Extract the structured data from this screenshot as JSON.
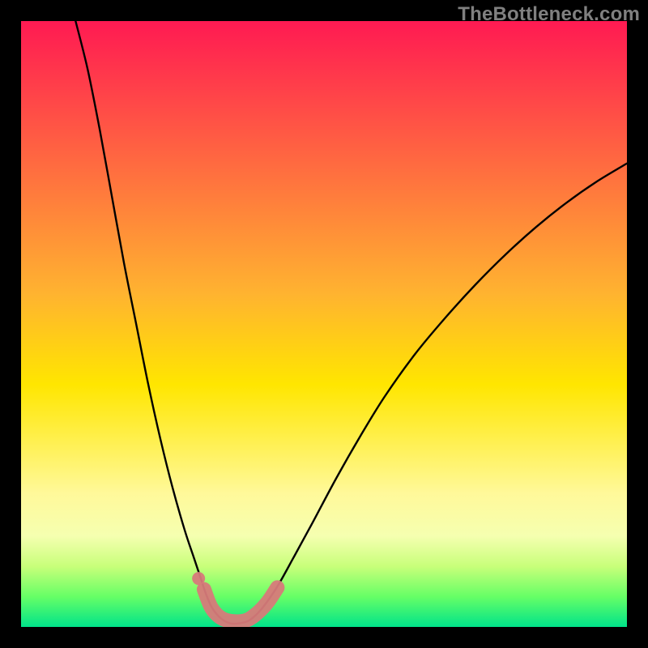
{
  "watermark": "TheBottleneck.com",
  "chart_data": {
    "type": "line",
    "title": "",
    "xlabel": "",
    "ylabel": "",
    "xlim": [
      0,
      100
    ],
    "ylim": [
      0,
      100
    ],
    "curve1_desc": "steep descending curve from top-left to trough",
    "curve2_desc": "ascending curve from trough to upper-right with diminishing slope",
    "trough_marker_desc": "rounded pink segment near bottom indicating optimal match zone",
    "background_gradient_stops": [
      {
        "offset": 0.0,
        "color": "#ff1a52"
      },
      {
        "offset": 0.45,
        "color": "#ffb330"
      },
      {
        "offset": 0.6,
        "color": "#ffe600"
      },
      {
        "offset": 0.78,
        "color": "#fff99a"
      },
      {
        "offset": 0.85,
        "color": "#f5ffb0"
      },
      {
        "offset": 0.9,
        "color": "#c8ff7a"
      },
      {
        "offset": 0.95,
        "color": "#66ff66"
      },
      {
        "offset": 1.0,
        "color": "#00e38a"
      }
    ],
    "curve1": [
      {
        "x": 9.0,
        "y": 100.0
      },
      {
        "x": 11.0,
        "y": 92.0
      },
      {
        "x": 13.0,
        "y": 82.0
      },
      {
        "x": 15.0,
        "y": 71.0
      },
      {
        "x": 17.0,
        "y": 60.0
      },
      {
        "x": 19.0,
        "y": 50.0
      },
      {
        "x": 21.0,
        "y": 40.0
      },
      {
        "x": 23.0,
        "y": 31.0
      },
      {
        "x": 25.0,
        "y": 23.0
      },
      {
        "x": 27.0,
        "y": 16.0
      },
      {
        "x": 28.5,
        "y": 11.5
      },
      {
        "x": 29.5,
        "y": 8.5
      },
      {
        "x": 30.5,
        "y": 5.5
      },
      {
        "x": 31.5,
        "y": 3.2
      },
      {
        "x": 33.0,
        "y": 1.4
      },
      {
        "x": 34.5,
        "y": 0.6
      },
      {
        "x": 36.0,
        "y": 0.6
      },
      {
        "x": 37.5,
        "y": 1.0
      },
      {
        "x": 39.0,
        "y": 2.2
      },
      {
        "x": 40.5,
        "y": 4.0
      },
      {
        "x": 42.5,
        "y": 7.0
      },
      {
        "x": 45.0,
        "y": 11.5
      },
      {
        "x": 48.0,
        "y": 17.0
      },
      {
        "x": 52.0,
        "y": 24.5
      },
      {
        "x": 56.0,
        "y": 31.5
      },
      {
        "x": 60.0,
        "y": 38.0
      },
      {
        "x": 65.0,
        "y": 45.0
      },
      {
        "x": 70.0,
        "y": 51.0
      },
      {
        "x": 75.0,
        "y": 56.5
      },
      {
        "x": 80.0,
        "y": 61.5
      },
      {
        "x": 85.0,
        "y": 66.0
      },
      {
        "x": 90.0,
        "y": 70.0
      },
      {
        "x": 95.0,
        "y": 73.5
      },
      {
        "x": 100.0,
        "y": 76.5
      }
    ],
    "marker_color": "#d77a7a",
    "marker_dot": {
      "x": 29.3,
      "y": 8.0,
      "r": 1.0
    },
    "marker_path": [
      {
        "x": 30.2,
        "y": 6.2
      },
      {
        "x": 31.4,
        "y": 3.2
      },
      {
        "x": 33.0,
        "y": 1.5
      },
      {
        "x": 35.0,
        "y": 0.9
      },
      {
        "x": 37.2,
        "y": 1.1
      },
      {
        "x": 39.0,
        "y": 2.3
      },
      {
        "x": 40.7,
        "y": 4.1
      },
      {
        "x": 42.3,
        "y": 6.5
      }
    ]
  }
}
